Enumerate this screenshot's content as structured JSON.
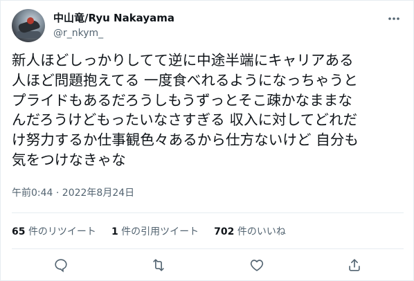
{
  "author": {
    "display_name": "中山竜/Ryu Nakayama",
    "handle": "@r_nkym_"
  },
  "icons": {
    "more": "more-horizontal-icon",
    "reply": "reply-icon",
    "retweet": "retweet-icon",
    "like": "like-heart-icon",
    "share": "share-icon"
  },
  "tweet": {
    "text": "新人ほどしっかりしてて逆に中途半端にキャリアある\n人ほど問題抱えてる 一度食べれるようになっちゃうと\nプライドもあるだろうしもうずっとそこ疎かなままな\nんだろうけどもったいなさすぎる 収入に対してどれだ\nけ努力するか仕事観色々あるから仕方ないけど 自分も\n気をつけなきゃな",
    "timestamp": "午前0:44 · 2022年8月24日"
  },
  "stats": {
    "retweets_count": "65",
    "retweets_label": "件のリツイート",
    "quotes_count": "1",
    "quotes_label": "件の引用ツイート",
    "likes_count": "702",
    "likes_label": "件のいいね"
  },
  "colors": {
    "text_primary": "#0f1419",
    "text_secondary": "#536471",
    "divider": "#e6ecf0"
  }
}
